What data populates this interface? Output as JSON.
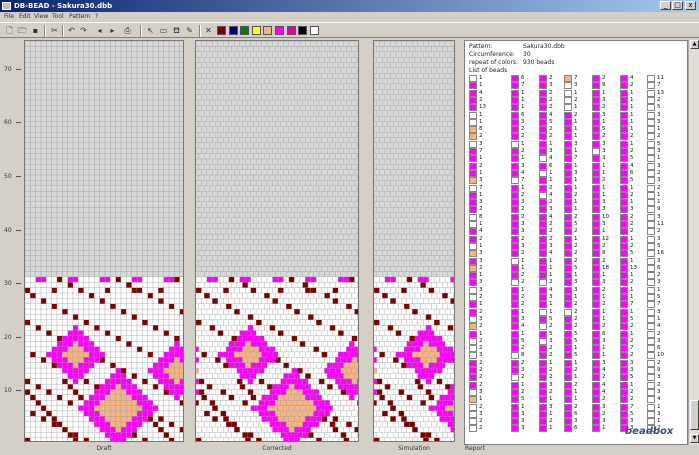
{
  "title": "DB-BEAD - Sakura30.dbb",
  "menu": [
    "File",
    "Edit",
    "View",
    "Tool",
    "Pattern",
    "?"
  ],
  "window_buttons": [
    "_",
    "□",
    "x"
  ],
  "palette": [
    "#800000",
    "#000080",
    "#008000",
    "#ffff00",
    "#f4b484",
    "#ff00ff",
    "#e000a0",
    "#000000",
    "#ffffff"
  ],
  "colors": {
    "grid": "#c8c8c8",
    "maroon": "#800000",
    "magenta": "#ff00ff",
    "peach": "#f4b484",
    "white": "#ffffff"
  },
  "ruler": [
    "70",
    "60",
    "50",
    "40",
    "30",
    "20",
    "10"
  ],
  "panels": {
    "draft": "Draft",
    "corrected": "Corrected",
    "simulation": "Simulation",
    "report": "Report"
  },
  "report": {
    "pattern_label": "Pattern:",
    "pattern_value": "Sakura30.dbb",
    "circ_label": "Circumference:",
    "circ_value": "30",
    "repeat_label": "repeat of colors:",
    "repeat_value": "930 beads",
    "list_label": "List of beads"
  },
  "bead_columns": [
    [
      [
        "w",
        "1"
      ],
      [
        "m",
        "1"
      ],
      [
        "m",
        "4"
      ],
      [
        "m",
        "2"
      ],
      [
        "m",
        "13"
      ],
      [
        "w",
        "1"
      ],
      [
        "w",
        "1"
      ],
      [
        "p",
        "8"
      ],
      [
        "p",
        "2"
      ],
      [
        "w",
        "3"
      ],
      [
        "m",
        "7"
      ],
      [
        "m",
        "1"
      ],
      [
        "m",
        "2"
      ],
      [
        "m",
        "1"
      ],
      [
        "p",
        "3"
      ],
      [
        "w",
        "7"
      ],
      [
        "m",
        "1"
      ],
      [
        "m",
        "3"
      ],
      [
        "m",
        "2"
      ],
      [
        "w",
        "8"
      ],
      [
        "w",
        "1"
      ],
      [
        "m",
        "4"
      ],
      [
        "m",
        "2"
      ],
      [
        "w",
        "1"
      ],
      [
        "p",
        "3"
      ],
      [
        "m",
        "3"
      ],
      [
        "p",
        "2"
      ],
      [
        "m",
        "1"
      ],
      [
        "m",
        "3"
      ],
      [
        "w",
        "3"
      ],
      [
        "w",
        "2"
      ],
      [
        "m",
        "1"
      ],
      [
        "m",
        "2"
      ],
      [
        "w",
        "3"
      ],
      [
        "p",
        "2"
      ],
      [
        "m",
        "1"
      ],
      [
        "w",
        "2"
      ],
      [
        "w",
        "2"
      ],
      [
        "w",
        "3"
      ],
      [
        "m",
        "2"
      ],
      [
        "m",
        "2"
      ],
      [
        "m",
        "2"
      ],
      [
        "m",
        "2"
      ],
      [
        "w",
        "3"
      ],
      [
        "p",
        "1"
      ],
      [
        "w",
        "2"
      ],
      [
        "w",
        "3"
      ],
      [
        "w",
        "2"
      ],
      [
        "w",
        "2"
      ]
    ],
    [
      [
        "m",
        "6"
      ],
      [
        "m",
        "7"
      ],
      [
        "m",
        "1"
      ],
      [
        "m",
        "1"
      ],
      [
        "m",
        "1"
      ],
      [
        "m",
        "6"
      ],
      [
        "m",
        "3"
      ],
      [
        "m",
        "2"
      ],
      [
        "m",
        "2"
      ],
      [
        "w",
        "1"
      ],
      [
        "m",
        "2"
      ],
      [
        "m",
        "1"
      ],
      [
        "m",
        "3"
      ],
      [
        "m",
        "4"
      ],
      [
        "w",
        "7"
      ],
      [
        "m",
        "1"
      ],
      [
        "m",
        "2"
      ],
      [
        "m",
        "3"
      ],
      [
        "m",
        "2"
      ],
      [
        "m",
        "2"
      ],
      [
        "m",
        "3"
      ],
      [
        "m",
        "3"
      ],
      [
        "m",
        "2"
      ],
      [
        "m",
        "3"
      ],
      [
        "m",
        "2"
      ],
      [
        "w",
        "1"
      ],
      [
        "m",
        "1"
      ],
      [
        "m",
        "2"
      ],
      [
        "w",
        "2"
      ],
      [
        "m",
        "1"
      ],
      [
        "m",
        "2"
      ],
      [
        "m",
        "2"
      ],
      [
        "m",
        "1"
      ],
      [
        "m",
        "3"
      ],
      [
        "m",
        "4"
      ],
      [
        "m",
        "1"
      ],
      [
        "m",
        "5"
      ],
      [
        "m",
        "2"
      ],
      [
        "w",
        "8"
      ],
      [
        "m",
        "2"
      ],
      [
        "m",
        "3"
      ],
      [
        "w",
        "2"
      ],
      [
        "m",
        "1"
      ],
      [
        "m",
        "2"
      ],
      [
        "m",
        "5"
      ],
      [
        "m",
        "1"
      ],
      [
        "m",
        "3"
      ],
      [
        "m",
        "3"
      ],
      [
        "m",
        "3"
      ]
    ],
    [
      [
        "m",
        "2"
      ],
      [
        "m",
        "3"
      ],
      [
        "m",
        "2"
      ],
      [
        "m",
        "2"
      ],
      [
        "m",
        "2"
      ],
      [
        "m",
        "4"
      ],
      [
        "m",
        "5"
      ],
      [
        "m",
        "2"
      ],
      [
        "m",
        "2"
      ],
      [
        "m",
        "1"
      ],
      [
        "m",
        "3"
      ],
      [
        "w",
        "4"
      ],
      [
        "m",
        "6"
      ],
      [
        "w",
        "1"
      ],
      [
        "m",
        "1"
      ],
      [
        "m",
        "2"
      ],
      [
        "w",
        "4"
      ],
      [
        "m",
        "2"
      ],
      [
        "m",
        "3"
      ],
      [
        "m",
        "4"
      ],
      [
        "m",
        "2"
      ],
      [
        "m",
        "2"
      ],
      [
        "m",
        "2"
      ],
      [
        "m",
        "3"
      ],
      [
        "m",
        "4"
      ],
      [
        "m",
        "1"
      ],
      [
        "m",
        "1"
      ],
      [
        "m",
        "1"
      ],
      [
        "w",
        "2"
      ],
      [
        "m",
        "4"
      ],
      [
        "m",
        "3"
      ],
      [
        "m",
        "1"
      ],
      [
        "w",
        "1"
      ],
      [
        "m",
        "5"
      ],
      [
        "w",
        "2"
      ],
      [
        "m",
        "5"
      ],
      [
        "w",
        "3"
      ],
      [
        "m",
        "2"
      ],
      [
        "m",
        "2"
      ],
      [
        "m",
        "1"
      ],
      [
        "m",
        "2"
      ],
      [
        "m",
        "2"
      ],
      [
        "m",
        "3"
      ],
      [
        "m",
        "2"
      ],
      [
        "m",
        "1"
      ],
      [
        "m",
        "3"
      ],
      [
        "m",
        "1"
      ],
      [
        "m",
        "2"
      ],
      [
        "m",
        "1"
      ]
    ],
    [
      [
        "p",
        "7"
      ],
      [
        "w",
        "3"
      ],
      [
        "w",
        "1"
      ],
      [
        "w",
        "2"
      ],
      [
        "w",
        "1"
      ],
      [
        "m",
        "2"
      ],
      [
        "m",
        "1"
      ],
      [
        "m",
        "1"
      ],
      [
        "m",
        "1"
      ],
      [
        "m",
        "3"
      ],
      [
        "m",
        "1"
      ],
      [
        "m",
        "7"
      ],
      [
        "m",
        "1"
      ],
      [
        "m",
        "3"
      ],
      [
        "m",
        "1"
      ],
      [
        "m",
        "1"
      ],
      [
        "m",
        "2"
      ],
      [
        "m",
        "1"
      ],
      [
        "m",
        "1"
      ],
      [
        "m",
        "2"
      ],
      [
        "m",
        "5"
      ],
      [
        "m",
        "2"
      ],
      [
        "m",
        "1"
      ],
      [
        "m",
        "2"
      ],
      [
        "m",
        "2"
      ],
      [
        "m",
        "2"
      ],
      [
        "m",
        "5"
      ],
      [
        "m",
        "1"
      ],
      [
        "m",
        "3"
      ],
      [
        "m",
        "3"
      ],
      [
        "m",
        "1"
      ],
      [
        "m",
        "2"
      ],
      [
        "w",
        "2"
      ],
      [
        "m",
        "2"
      ],
      [
        "m",
        "2"
      ],
      [
        "m",
        "5"
      ],
      [
        "m",
        "5"
      ],
      [
        "m",
        "1"
      ],
      [
        "m",
        "5"
      ],
      [
        "m",
        "1"
      ],
      [
        "m",
        "2"
      ],
      [
        "m",
        "1"
      ],
      [
        "m",
        "2"
      ],
      [
        "m",
        "1"
      ],
      [
        "m",
        "1"
      ],
      [
        "m",
        "2"
      ],
      [
        "m",
        "6"
      ],
      [
        "m",
        "3"
      ],
      [
        "m",
        "6"
      ]
    ],
    [
      [
        "m",
        "2"
      ],
      [
        "m",
        "9"
      ],
      [
        "m",
        "1"
      ],
      [
        "m",
        "3"
      ],
      [
        "m",
        "2"
      ],
      [
        "m",
        "3"
      ],
      [
        "m",
        "1"
      ],
      [
        "m",
        "5"
      ],
      [
        "m",
        "2"
      ],
      [
        "m",
        "3"
      ],
      [
        "w",
        "3"
      ],
      [
        "m",
        "3"
      ],
      [
        "m",
        "1"
      ],
      [
        "m",
        "1"
      ],
      [
        "m",
        "2"
      ],
      [
        "m",
        "1"
      ],
      [
        "m",
        "1"
      ],
      [
        "m",
        "3"
      ],
      [
        "m",
        "3"
      ],
      [
        "m",
        "10"
      ],
      [
        "m",
        "3"
      ],
      [
        "m",
        "1"
      ],
      [
        "m",
        "12"
      ],
      [
        "m",
        "2"
      ],
      [
        "m",
        "9"
      ],
      [
        "m",
        "2"
      ],
      [
        "m",
        "18"
      ],
      [
        "m",
        "1"
      ],
      [
        "m",
        "3"
      ],
      [
        "m",
        "2"
      ],
      [
        "m",
        "1"
      ],
      [
        "m",
        "2"
      ],
      [
        "m",
        "1"
      ],
      [
        "m",
        "1"
      ],
      [
        "m",
        "2"
      ],
      [
        "m",
        "6"
      ],
      [
        "m",
        "3"
      ],
      [
        "m",
        "1"
      ],
      [
        "m",
        "1"
      ],
      [
        "m",
        "3"
      ],
      [
        "m",
        "4"
      ],
      [
        "m",
        "2"
      ],
      [
        "m",
        "4"
      ],
      [
        "m",
        "4"
      ],
      [
        "m",
        "2"
      ],
      [
        "m",
        "3"
      ],
      [
        "m",
        "2"
      ],
      [
        "m",
        "3"
      ],
      [
        "m",
        "1"
      ]
    ],
    [
      [
        "m",
        "4"
      ],
      [
        "m",
        "2"
      ],
      [
        "m",
        "1"
      ],
      [
        "m",
        "1"
      ],
      [
        "m",
        "1"
      ],
      [
        "m",
        "1"
      ],
      [
        "m",
        "1"
      ],
      [
        "m",
        "1"
      ],
      [
        "m",
        "2"
      ],
      [
        "m",
        "1"
      ],
      [
        "m",
        "2"
      ],
      [
        "m",
        "5"
      ],
      [
        "m",
        "4"
      ],
      [
        "m",
        "6"
      ],
      [
        "m",
        "5"
      ],
      [
        "m",
        "1"
      ],
      [
        "m",
        "2"
      ],
      [
        "m",
        "1"
      ],
      [
        "m",
        "3"
      ],
      [
        "m",
        "2"
      ],
      [
        "m",
        "2"
      ],
      [
        "m",
        "2"
      ],
      [
        "m",
        "1"
      ],
      [
        "m",
        "2"
      ],
      [
        "m",
        "5"
      ],
      [
        "m",
        "1"
      ],
      [
        "m",
        "13"
      ],
      [
        "m",
        "1"
      ],
      [
        "m",
        "2"
      ],
      [
        "m",
        "1"
      ],
      [
        "m",
        "1"
      ],
      [
        "m",
        "7"
      ],
      [
        "m",
        "1"
      ],
      [
        "m",
        "5"
      ],
      [
        "m",
        "2"
      ],
      [
        "m",
        "1"
      ],
      [
        "m",
        "2"
      ],
      [
        "m",
        "7"
      ],
      [
        "m",
        "2"
      ],
      [
        "m",
        "3"
      ],
      [
        "m",
        "3"
      ],
      [
        "m",
        "5"
      ],
      [
        "m",
        "1"
      ],
      [
        "m",
        "2"
      ],
      [
        "m",
        "2"
      ],
      [
        "m",
        "7"
      ],
      [
        "m",
        "5"
      ],
      [
        "m",
        "3"
      ],
      [
        "m",
        "3"
      ]
    ],
    [
      [
        "w",
        "11"
      ],
      [
        "w",
        "7"
      ],
      [
        "w",
        "13"
      ],
      [
        "w",
        "2"
      ],
      [
        "w",
        "5"
      ],
      [
        "w",
        "3"
      ],
      [
        "w",
        "3"
      ],
      [
        "w",
        "1"
      ],
      [
        "w",
        "2"
      ],
      [
        "w",
        "5"
      ],
      [
        "w",
        "3"
      ],
      [
        "w",
        "1"
      ],
      [
        "w",
        "3"
      ],
      [
        "w",
        "2"
      ],
      [
        "w",
        "3"
      ],
      [
        "w",
        "2"
      ],
      [
        "w",
        "1"
      ],
      [
        "w",
        "1"
      ],
      [
        "w",
        "9"
      ],
      [
        "w",
        "3"
      ],
      [
        "w",
        "11"
      ],
      [
        "w",
        "2"
      ],
      [
        "w",
        "3"
      ],
      [
        "w",
        "5"
      ],
      [
        "w",
        "16"
      ],
      [
        "w",
        "3"
      ],
      [
        "w",
        "6"
      ],
      [
        "w",
        "2"
      ],
      [
        "w",
        "3"
      ],
      [
        "w",
        "1"
      ],
      [
        "w",
        "5"
      ],
      [
        "w",
        "7"
      ],
      [
        "w",
        "3"
      ],
      [
        "w",
        "1"
      ],
      [
        "w",
        "4"
      ],
      [
        "w",
        "2"
      ],
      [
        "w",
        "3"
      ],
      [
        "w",
        "6"
      ],
      [
        "w",
        "10"
      ],
      [
        "w",
        "2"
      ],
      [
        "w",
        "9"
      ],
      [
        "w",
        "3"
      ],
      [
        "w",
        "2"
      ],
      [
        "w",
        "3"
      ],
      [
        "w",
        "4"
      ],
      [
        "w",
        "1"
      ],
      [
        "w",
        "3"
      ],
      [
        "w",
        "1"
      ],
      [
        "w",
        "2"
      ]
    ]
  ],
  "logo": "beadbox"
}
